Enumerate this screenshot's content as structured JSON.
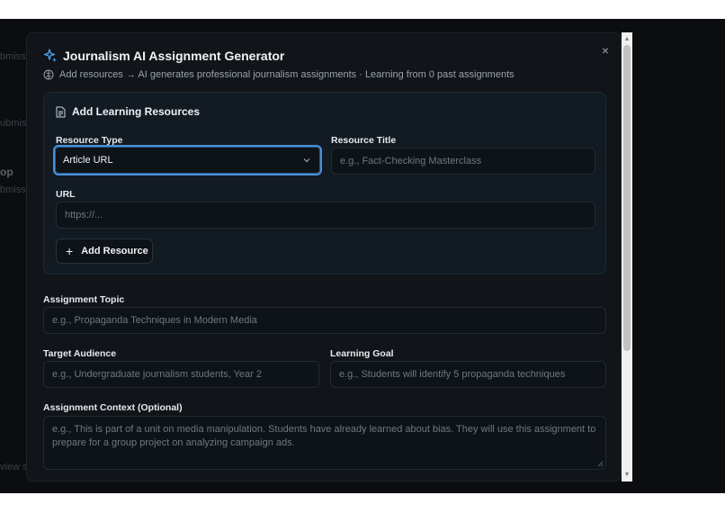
{
  "background": {
    "fragments": [
      "bmiss",
      "ubmiss",
      "op",
      "bmiss",
      "view su"
    ]
  },
  "modal": {
    "title": "Journalism AI Assignment Generator",
    "title_icon": "sparkles-icon",
    "subtitle": "Add resources → AI generates professional journalism assignments · Learning from 0 past assignments",
    "subtitle_icon": "brain-icon",
    "close_label": "×"
  },
  "resources": {
    "heading": "Add Learning Resources",
    "heading_icon": "document-icon",
    "type_label": "Resource Type",
    "type_value": "Article URL",
    "title_label": "Resource Title",
    "title_placeholder": "e.g., Fact-Checking Masterclass",
    "url_label": "URL",
    "url_placeholder": "https://...",
    "add_button": "Add Resource",
    "add_icon": "+"
  },
  "assignment": {
    "topic_label": "Assignment Topic",
    "topic_placeholder": "e.g., Propaganda Techniques in Modern Media",
    "audience_label": "Target Audience",
    "audience_placeholder": "e.g., Undergraduate journalism students, Year 2",
    "goal_label": "Learning Goal",
    "goal_placeholder": "e.g., Students will identify 5 propaganda techniques",
    "context_label": "Assignment Context (Optional)",
    "context_placeholder": "e.g., This is part of a unit on media manipulation. Students have already learned about bias. They will use this assignment to prepare for a group project on analyzing campaign ads."
  },
  "colors": {
    "accent": "#4a8fd8",
    "modal_bg": "#111418",
    "card_bg": "#121a22"
  }
}
